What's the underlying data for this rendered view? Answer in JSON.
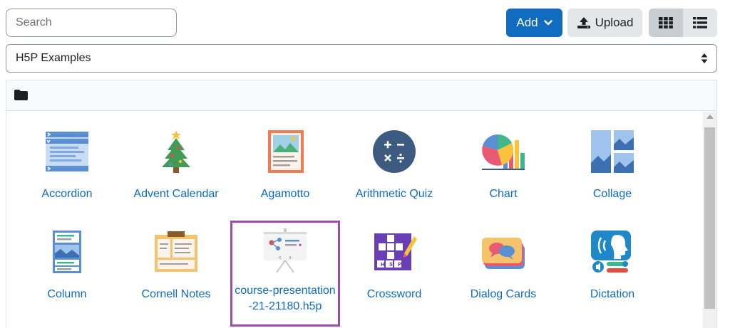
{
  "toolbar": {
    "search_placeholder": "Search",
    "add_label": "Add",
    "upload_label": "Upload",
    "accent_color": "#0f6cbf"
  },
  "repository": {
    "selected": "H5P Examples"
  },
  "files": [
    {
      "label": "Accordion",
      "icon": "accordion-icon"
    },
    {
      "label": "Advent Calendar",
      "icon": "christmas-tree-icon"
    },
    {
      "label": "Agamotto",
      "icon": "picture-frame-icon"
    },
    {
      "label": "Arithmetic Quiz",
      "icon": "arithmetic-icon"
    },
    {
      "label": "Chart",
      "icon": "chart-icon"
    },
    {
      "label": "Collage",
      "icon": "collage-icon"
    },
    {
      "label": "Column",
      "icon": "column-icon"
    },
    {
      "label": "Cornell Notes",
      "icon": "notes-icon"
    },
    {
      "label": "course-presentation-21-21180.h5p",
      "icon": "presentation-icon",
      "selected": true
    },
    {
      "label": "Crossword",
      "icon": "crossword-icon"
    },
    {
      "label": "Dialog Cards",
      "icon": "dialog-cards-icon"
    },
    {
      "label": "Dictation",
      "icon": "dictation-icon"
    }
  ],
  "selection_color": "#9b4da8"
}
